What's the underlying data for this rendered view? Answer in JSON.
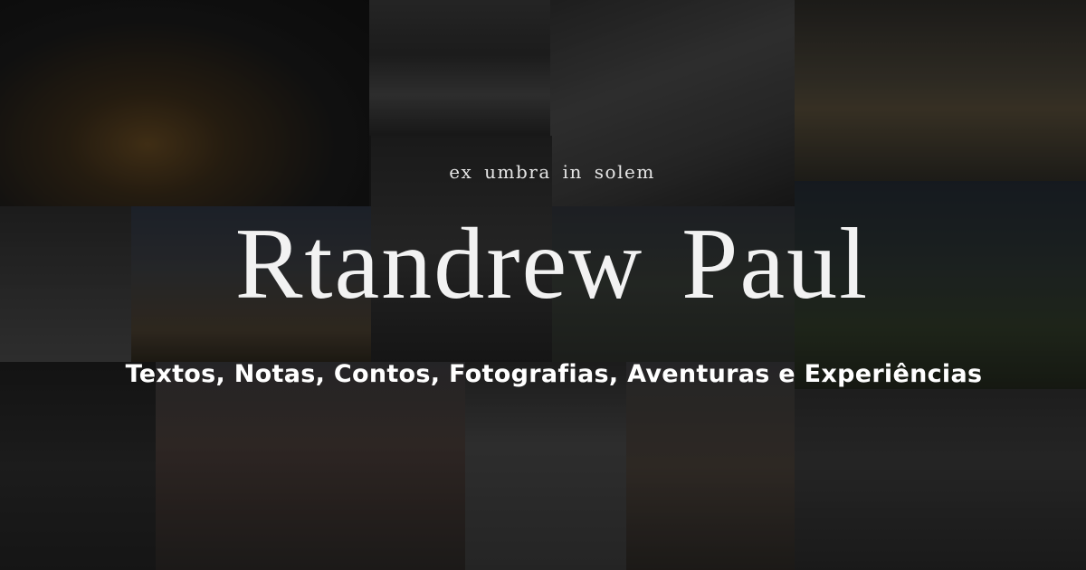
{
  "header": {
    "tagline": "ex umbra in solem",
    "title": "Rtandrew Paul",
    "subtitle": "Textos, Notas, Contos, Fotografias, Aventuras e Experiências"
  },
  "background": {
    "type": "photo-collage",
    "overlay_color": "#0a0a0a"
  }
}
